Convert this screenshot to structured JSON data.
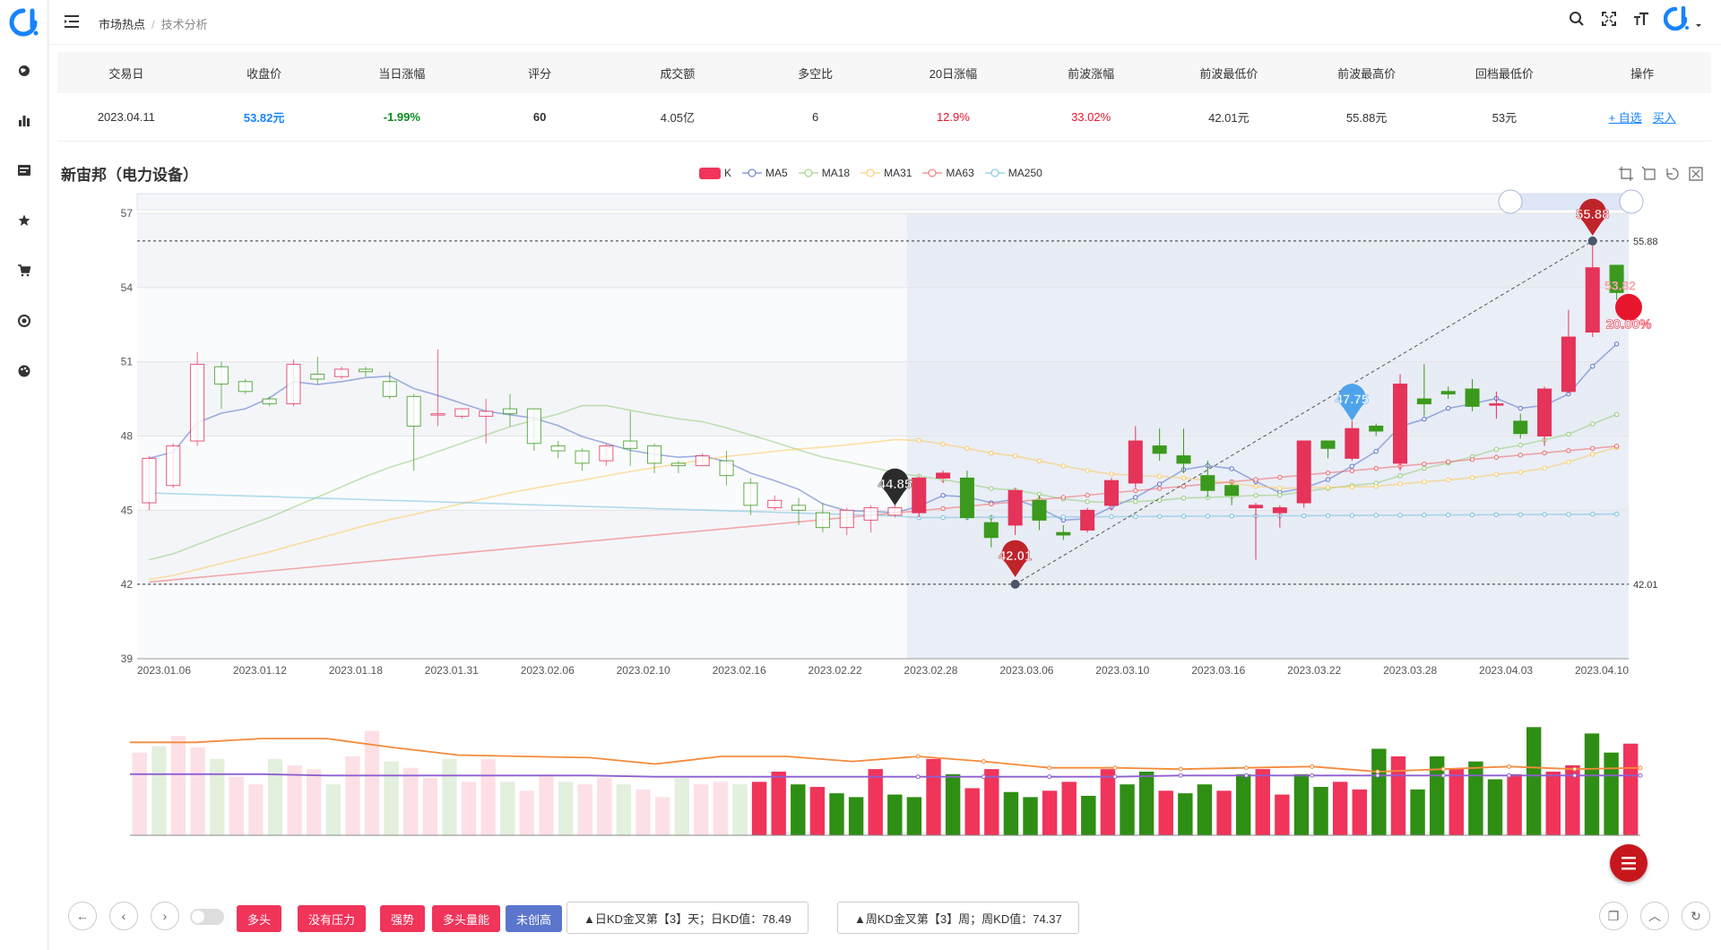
{
  "breadcrumb": {
    "root": "市场热点",
    "current": "技术分析"
  },
  "table": {
    "headers": [
      "交易日",
      "收盘价",
      "当日涨幅",
      "评分",
      "成交额",
      "多空比",
      "20日涨幅",
      "前波涨幅",
      "前波最低价",
      "前波最高价",
      "回档最低价",
      "操作"
    ],
    "row": {
      "date": "2023.04.11",
      "close": "53.82元",
      "change": "-1.99%",
      "score": "60",
      "turnover": "4.05亿",
      "ratio": "6",
      "change20": "12.9%",
      "prev_wave": "33.02%",
      "prev_low": "42.01元",
      "prev_high": "55.88元",
      "pullback_low": "53元"
    },
    "actions": {
      "watch": "+ 自选",
      "buy": "买入"
    }
  },
  "chart_title": "新宙邦（电力设备）",
  "legend": [
    {
      "name": "K",
      "color": "#f0345a"
    },
    {
      "name": "MA5",
      "color": "#5470c6"
    },
    {
      "name": "MA18",
      "color": "#91cc75"
    },
    {
      "name": "MA31",
      "color": "#fac858"
    },
    {
      "name": "MA63",
      "color": "#ee6666"
    },
    {
      "name": "MA250",
      "color": "#73c0de"
    }
  ],
  "chart_data": {
    "type": "candlestick",
    "ylim": [
      39,
      57
    ],
    "yticks": [
      "57",
      "54",
      "51",
      "48",
      "45",
      "42",
      "39"
    ],
    "xticks": [
      "2023.01.06",
      "2023.01.12",
      "2023.01.18",
      "2023.01.31",
      "2023.02.06",
      "2023.02.10",
      "2023.02.16",
      "2023.02.22",
      "2023.02.28",
      "2023.03.06",
      "2023.03.10",
      "2023.03.16",
      "2023.03.22",
      "2023.03.28",
      "2023.04.03",
      "2023.04.10"
    ],
    "candles": [
      [
        45.3,
        47.1,
        45.0,
        47.2
      ],
      [
        46.0,
        47.6,
        45.9,
        47.7
      ],
      [
        47.8,
        50.9,
        47.6,
        51.4
      ],
      [
        50.8,
        50.1,
        49.1,
        51.0
      ],
      [
        50.2,
        49.8,
        49.7,
        50.3
      ],
      [
        49.5,
        49.3,
        49.2,
        49.6
      ],
      [
        49.3,
        50.9,
        49.2,
        51.1
      ],
      [
        50.5,
        50.3,
        50.1,
        51.2
      ],
      [
        50.4,
        50.7,
        50.3,
        50.8
      ],
      [
        50.7,
        50.6,
        50.4,
        50.8
      ],
      [
        50.2,
        49.6,
        49.5,
        50.6
      ],
      [
        49.6,
        48.4,
        46.6,
        49.7
      ],
      [
        48.9,
        48.9,
        48.4,
        51.5
      ],
      [
        48.8,
        49.1,
        48.7,
        49.1
      ],
      [
        48.8,
        49.0,
        47.7,
        49.5
      ],
      [
        49.1,
        48.9,
        48.4,
        49.7
      ],
      [
        49.1,
        47.7,
        47.4,
        49.1
      ],
      [
        47.6,
        47.4,
        47.1,
        47.8
      ],
      [
        47.4,
        46.9,
        46.6,
        47.5
      ],
      [
        47.0,
        47.6,
        46.8,
        47.7
      ],
      [
        47.8,
        47.5,
        46.8,
        49.0
      ],
      [
        47.6,
        46.9,
        46.5,
        47.7
      ],
      [
        46.9,
        46.8,
        46.5,
        47.0
      ],
      [
        46.8,
        47.2,
        46.8,
        47.3
      ],
      [
        47.0,
        46.4,
        46.0,
        47.4
      ],
      [
        46.1,
        45.2,
        44.8,
        46.3
      ],
      [
        45.1,
        45.4,
        45.0,
        45.6
      ],
      [
        45.2,
        45.0,
        44.4,
        45.5
      ],
      [
        44.9,
        44.3,
        44.1,
        45.3
      ],
      [
        44.3,
        45.0,
        44.0,
        45.1
      ],
      [
        44.6,
        45.1,
        44.1,
        45.2
      ],
      [
        44.8,
        45.1,
        44.7,
        45.4
      ],
      [
        44.9,
        46.3,
        44.7,
        46.4
      ],
      [
        46.3,
        46.5,
        46.1,
        46.6
      ],
      [
        46.3,
        44.7,
        44.6,
        46.6
      ],
      [
        44.5,
        43.9,
        43.5,
        44.8
      ],
      [
        44.4,
        45.8,
        44.0,
        45.9
      ],
      [
        45.4,
        44.6,
        44.2,
        45.6
      ],
      [
        44.1,
        44.0,
        43.8,
        44.4
      ],
      [
        44.2,
        45.0,
        44.1,
        45.1
      ],
      [
        45.2,
        46.2,
        45.0,
        46.3
      ],
      [
        46.1,
        47.8,
        45.9,
        48.4
      ],
      [
        47.6,
        47.3,
        47.0,
        48.3
      ],
      [
        47.2,
        46.9,
        46.5,
        48.3
      ],
      [
        46.4,
        45.8,
        45.5,
        47.0
      ],
      [
        46.0,
        45.6,
        45.2,
        46.2
      ],
      [
        45.1,
        45.2,
        43.0,
        45.3
      ],
      [
        44.9,
        45.1,
        44.3,
        45.2
      ],
      [
        45.3,
        47.8,
        45.1,
        47.8
      ],
      [
        47.8,
        47.5,
        47.1,
        47.8
      ],
      [
        47.1,
        48.3,
        47.0,
        48.6
      ],
      [
        48.4,
        48.2,
        48.0,
        48.5
      ],
      [
        46.9,
        50.1,
        46.6,
        50.5
      ],
      [
        49.5,
        49.3,
        48.8,
        50.9
      ],
      [
        49.8,
        49.7,
        49.5,
        50.0
      ],
      [
        49.9,
        49.2,
        49.0,
        50.3
      ],
      [
        49.3,
        49.3,
        48.7,
        49.8
      ],
      [
        48.6,
        48.1,
        47.9,
        48.9
      ],
      [
        48.0,
        49.9,
        47.6,
        50.0
      ],
      [
        49.8,
        52.0,
        49.7,
        53.1
      ],
      [
        52.2,
        54.8,
        52.0,
        55.7
      ],
      [
        54.9,
        53.8,
        53.5,
        54.9
      ]
    ],
    "volume_ylim": [
      0,
      100
    ],
    "volume": [
      65,
      70,
      78,
      69,
      60,
      46,
      40,
      60,
      55,
      52,
      40,
      62,
      82,
      58,
      53,
      45,
      60,
      42,
      60,
      42,
      35,
      48,
      42,
      40,
      45,
      40,
      36,
      30,
      45,
      40,
      42,
      40,
      42,
      50,
      40,
      38,
      33,
      30,
      52,
      32,
      30,
      60,
      48,
      37,
      52,
      34,
      30,
      35,
      42,
      31,
      52,
      40,
      50,
      35,
      33,
      40,
      35,
      48,
      52,
      32,
      48,
      38,
      42,
      36,
      68,
      62,
      36,
      62,
      52,
      58,
      44,
      48,
      85,
      50,
      55,
      80,
      65,
      72
    ],
    "volume_ma_orange": [
      73,
      73,
      76,
      76,
      69,
      63,
      62,
      61,
      56,
      62,
      62,
      58,
      62,
      58,
      53,
      53,
      52,
      53,
      54,
      50,
      52,
      54,
      52,
      53
    ],
    "volume_ma_purple": [
      48,
      48,
      48,
      47,
      47,
      47,
      47,
      47,
      46,
      46,
      46,
      46,
      46,
      46,
      46,
      46,
      47,
      47,
      47,
      47,
      47,
      47,
      47,
      47
    ],
    "markers": {
      "high": "55.88",
      "low": "42.01",
      "cur": "44.85",
      "mid": "47.75",
      "pct": "20.00%",
      "close": "53.82"
    },
    "hlines": {
      "high": "55.88",
      "low": "42.01"
    }
  },
  "bottom": {
    "tags": [
      {
        "label": "多头",
        "color": "#f0345a"
      },
      {
        "label": "没有压力",
        "color": "#f0345a"
      },
      {
        "label": "强势",
        "color": "#f0345a"
      },
      {
        "label": "多头量能",
        "color": "#f0345a"
      },
      {
        "label": "未创高",
        "color": "#5b76cc"
      }
    ],
    "kd_day": "▲日KD金叉第【3】天；日KD值：78.49",
    "kd_week": "▲周KD金叉第【3】周；周KD值：74.37"
  }
}
